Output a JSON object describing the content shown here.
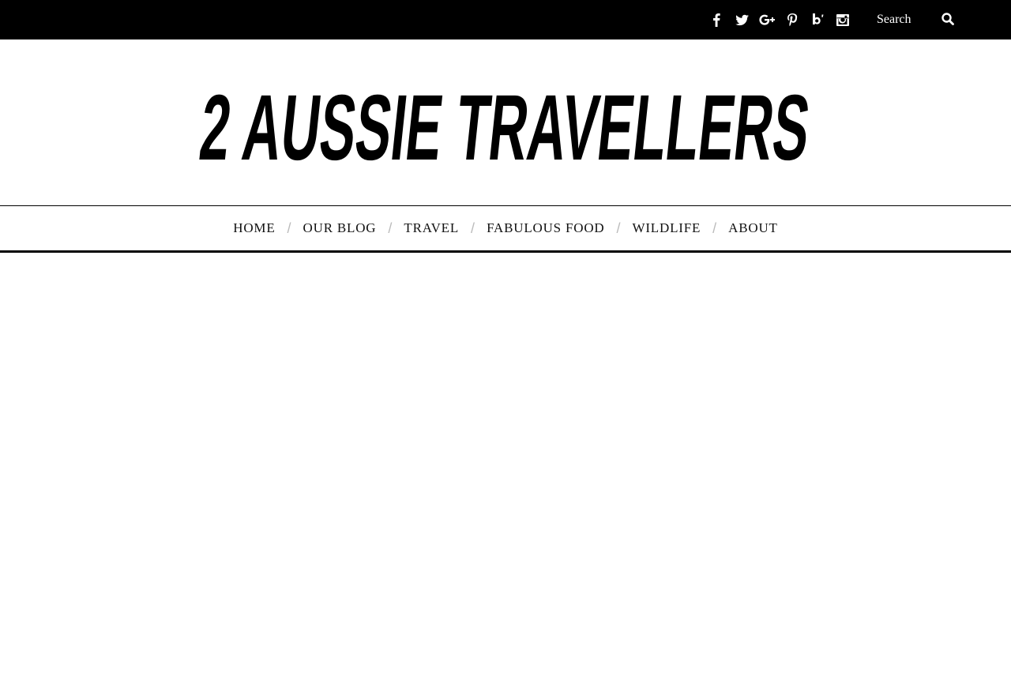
{
  "topbar": {
    "social": [
      {
        "icon": "facebook-icon"
      },
      {
        "icon": "twitter-icon"
      },
      {
        "icon": "google-plus-icon"
      },
      {
        "icon": "pinterest-icon"
      },
      {
        "icon": "bloglovin-icon"
      },
      {
        "icon": "instagram-icon"
      }
    ],
    "search_placeholder": "Search",
    "search_icon": "search-icon"
  },
  "logo": {
    "text": "2 AUSSIE TRAVELLERS"
  },
  "nav": {
    "items": [
      "HOME",
      "OUR BLOG",
      "TRAVEL",
      "FABULOUS FOOD",
      "WILDLIFE",
      "ABOUT"
    ],
    "separator": "/"
  },
  "colors": {
    "topbar_bg": "#000000",
    "text": "#111111",
    "separator": "#bbbbbb"
  }
}
